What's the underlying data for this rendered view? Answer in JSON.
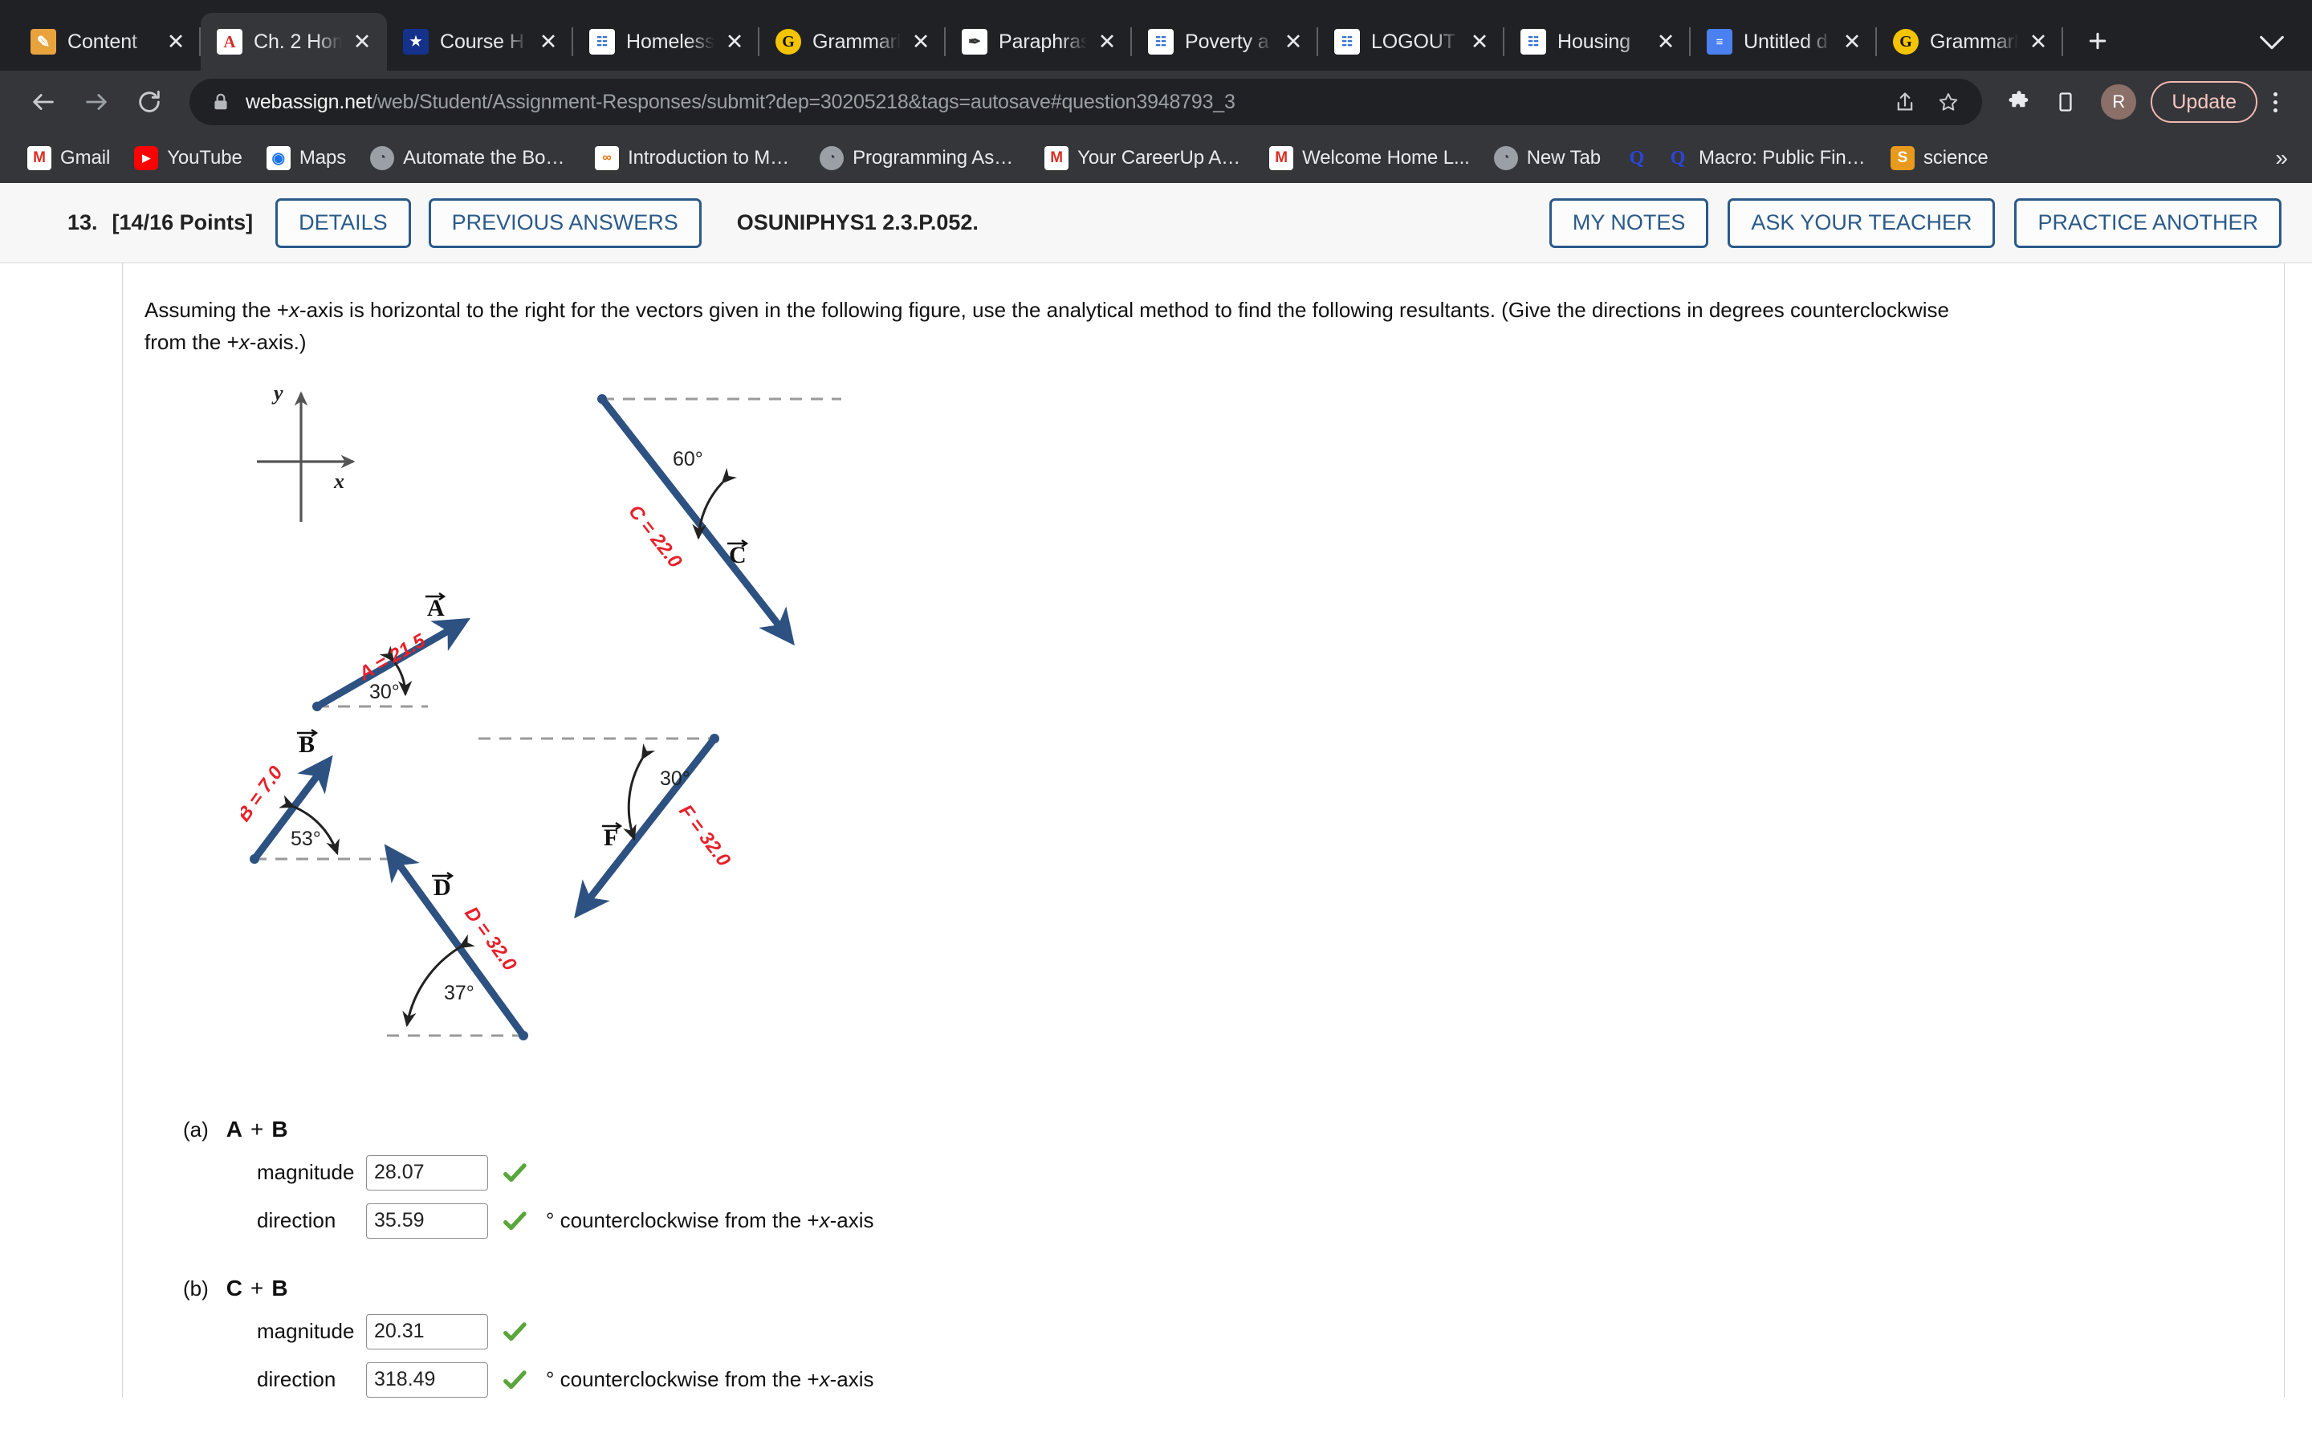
{
  "browser": {
    "tabs": [
      {
        "title": "Content",
        "icon": "pencil-notebook-icon",
        "active": false
      },
      {
        "title": "Ch. 2 Hom",
        "icon": "webassign-icon",
        "active": true
      },
      {
        "title": "Course H",
        "icon": "shield-star-icon",
        "active": false
      },
      {
        "title": "Homeless",
        "icon": "document-blue-icon",
        "active": false
      },
      {
        "title": "Grammarl",
        "icon": "grammarly-icon",
        "active": false
      },
      {
        "title": "Paraphras",
        "icon": "quill-pen-icon",
        "active": false
      },
      {
        "title": "Poverty a",
        "icon": "document-blue-icon",
        "active": false
      },
      {
        "title": "LOGOUT",
        "icon": "document-blue-icon",
        "active": false
      },
      {
        "title": "Housing ",
        "icon": "document-blue-icon",
        "active": false
      },
      {
        "title": "Untitled d",
        "icon": "slides-icon",
        "active": false
      },
      {
        "title": "Grammarl",
        "icon": "grammarly-icon",
        "active": false
      }
    ],
    "new_tab_label": "+",
    "tab_close_label": "✕",
    "tabstrip_chevron": "⌄",
    "url_domain": "webassign.net",
    "url_path": "/web/Student/Assignment-Responses/submit?dep=30205218&tags=autosave#question3948793_3",
    "profile_initial": "R",
    "update_label": "Update",
    "bookmarks": [
      {
        "label": "Gmail",
        "icon": "gmail-icon"
      },
      {
        "label": "YouTube",
        "icon": "youtube-icon"
      },
      {
        "label": "Maps",
        "icon": "maps-icon"
      },
      {
        "label": "Automate the Bori...",
        "icon": "globe-icon"
      },
      {
        "label": "Introduction to Ma...",
        "icon": "colab-icon"
      },
      {
        "label": "Programming Assi...",
        "icon": "globe-icon"
      },
      {
        "label": "Your CareerUp Ac...",
        "icon": "gmail-m-icon"
      },
      {
        "label": "Welcome Home L...",
        "icon": "gmail-m-icon"
      },
      {
        "label": "New Tab",
        "icon": "globe-icon"
      },
      {
        "label": "",
        "icon": "quora-icon"
      },
      {
        "label": "Macro: Public Fina...",
        "icon": "quora-icon"
      },
      {
        "label": "science",
        "icon": "s-orange-icon"
      }
    ],
    "bookmarks_overflow": "»"
  },
  "question_header": {
    "number": "13.",
    "points": "[14/16 Points]",
    "details_label": "DETAILS",
    "previous_answers_label": "PREVIOUS ANSWERS",
    "code": "OSUNIPHYS1 2.3.P.052.",
    "my_notes_label": "MY NOTES",
    "ask_teacher_label": "ASK YOUR TEACHER",
    "practice_another_label": "PRACTICE ANOTHER"
  },
  "question": {
    "line1": "Assuming the +x-axis is horizontal to the right for the vectors given in the following figure, use the analytical method to find the following resultants. (Give the directions in degrees counterclockwise",
    "line2": "from the +x-axis.)"
  },
  "figure": {
    "axis_y_label": "y",
    "axis_x_label": "x",
    "vectors": [
      {
        "name": "A",
        "label": "⃗A",
        "magnitude_text": "A = 21.5",
        "magnitude": 21.5,
        "angle_text": "30°",
        "angle": 30
      },
      {
        "name": "C",
        "label": "⃗C",
        "magnitude_text": "C = 22.0",
        "magnitude": 22.0,
        "angle_text": "60°",
        "angle": 60
      },
      {
        "name": "B",
        "label": "⃗B",
        "magnitude_text": "B = 7.0",
        "magnitude": 7.0,
        "angle_text": "53°",
        "angle": 53
      },
      {
        "name": "D",
        "label": "⃗D",
        "magnitude_text": "D = 32.0",
        "magnitude": 32.0,
        "angle_text": "37°",
        "angle": 37
      },
      {
        "name": "F",
        "label": "⃗F",
        "magnitude_text": "F = 32.0",
        "magnitude": 32.0,
        "angle_text": "30°",
        "angle": 30
      }
    ],
    "vector_color": "#2d5181",
    "magnitude_color": "#e8202a",
    "dash_color": "#9a9a9a"
  },
  "parts": [
    {
      "letter": "(a)",
      "v1": "A",
      "v2": "B",
      "plus": "+",
      "magnitude_label": "magnitude",
      "magnitude_value": "28.07",
      "direction_label": "direction",
      "direction_value": "35.59",
      "unit_text": "° counterclockwise from the +x-axis",
      "correct": true
    },
    {
      "letter": "(b)",
      "v1": "C",
      "v2": "B",
      "plus": "+",
      "magnitude_label": "magnitude",
      "magnitude_value": "20.31",
      "direction_label": "direction",
      "direction_value": "318.49",
      "unit_text": "° counterclockwise from the +x-axis",
      "correct": true
    }
  ],
  "colors": {
    "accent_blue": "#2a5a8a",
    "chrome_dark": "#202124",
    "chrome_mid": "#35363a",
    "check_green": "#5aa63c"
  }
}
